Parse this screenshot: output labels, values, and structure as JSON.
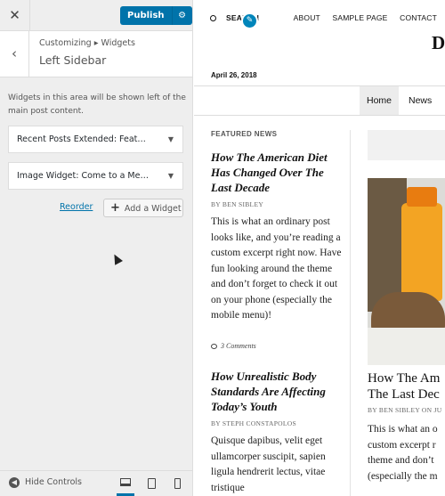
{
  "customizer": {
    "publish_label": "Publish",
    "breadcrumb": "Customizing ▸ Widgets",
    "section_title": "Left Sidebar",
    "description_line1": "Widgets in this area will be shown left of the",
    "description_line2": "main post content.",
    "widgets": [
      {
        "label": "Recent Posts Extended: Feat…"
      },
      {
        "label": "Image Widget: Come to a Me…"
      }
    ],
    "reorder_label": "Reorder",
    "add_widget_label": "Add a Widget",
    "hide_controls_label": "Hide Controls"
  },
  "preview": {
    "nav": {
      "search_label": "SEARCH",
      "items": [
        "ABOUT",
        "SAMPLE PAGE",
        "CONTACT"
      ]
    },
    "logo_fragment": "D",
    "date": "April 26, 2018",
    "menu": [
      "Home",
      "News"
    ],
    "featured_heading": "FEATURED NEWS",
    "posts": [
      {
        "title": "How The American Diet Has Changed Over The Last Decade",
        "byline": "BY BEN SIBLEY",
        "excerpt": "This is what an ordinary post looks like, and you’re reading a custom excerpt right now. Have fun looking around the theme and don’t forget to check it out on your phone (especially the mobile menu)!",
        "comments": "3 Comments"
      },
      {
        "title": "How Unrealistic Body Standards Are Affecting Today’s Youth",
        "byline": "BY STEPH CONSTAPOLOS",
        "excerpt": "Quisque dapibus, velit eget ullamcorper suscipit, sapien ligula hendrerit lectus, vitae tristique"
      }
    ],
    "side_post": {
      "title_line1": "How The Am",
      "title_line2": "The Last Dec",
      "byline": "BY BEN SIBLEY ON JU",
      "excerpt_lines": [
        "This is what an o",
        "custom excerpt r",
        "theme and don’t",
        "(especially the m"
      ]
    }
  },
  "colors": {
    "accent": "#0073aa",
    "panel_bg": "#eeeeee",
    "edit_shortcut": "#0085ba"
  }
}
